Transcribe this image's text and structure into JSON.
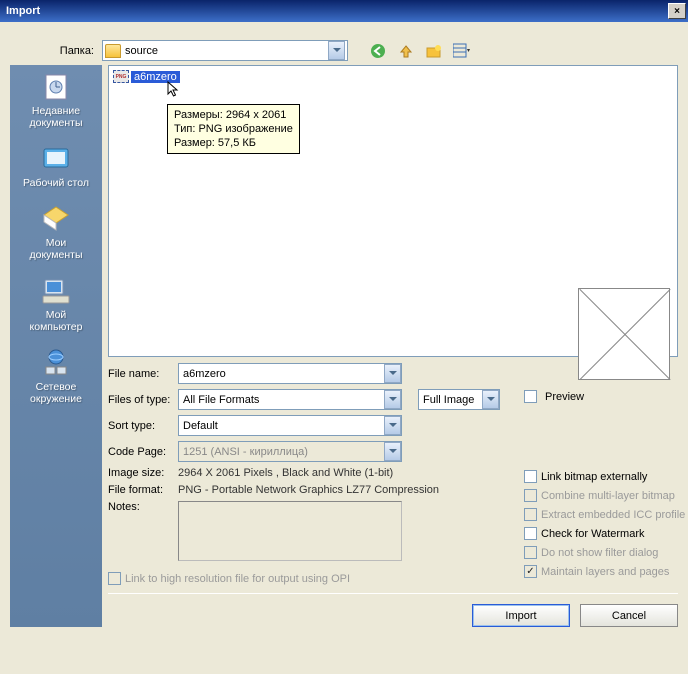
{
  "title": "Import",
  "folder_label": "Папка:",
  "folder_value": "source",
  "places": [
    {
      "label": "Недавние\nдокументы"
    },
    {
      "label": "Рабочий стол"
    },
    {
      "label": "Мои\nдокументы"
    },
    {
      "label": "Мой\nкомпьютер"
    },
    {
      "label": "Сетевое\nокружение"
    }
  ],
  "file_item": "a6mzero",
  "tooltip": {
    "l1": "Размеры: 2964 x 2061",
    "l2": "Тип: PNG изображение",
    "l3": "Размер: 57,5 КБ"
  },
  "form": {
    "file_name_lbl": "File name:",
    "file_name_val": "a6mzero",
    "files_type_lbl": "Files of type:",
    "files_type_val": "All File Formats",
    "full_image": "Full Image",
    "preview_chk": "Preview",
    "sort_lbl": "Sort type:",
    "sort_val": "Default",
    "codepage_lbl": "Code Page:",
    "codepage_val": "1251 (ANSI - кириллица)",
    "imgsize_lbl": "Image size:",
    "imgsize_val": "2964 X 2061 Pixels , Black and White (1-bit)",
    "fileformat_lbl": "File format:",
    "fileformat_val": "PNG - Portable Network Graphics LZ77 Compression",
    "notes_lbl": "Notes:"
  },
  "checks": {
    "link_bitmap": "Link bitmap externally",
    "combine": "Combine multi-layer bitmap",
    "extract_icc": "Extract embedded ICC profile",
    "watermark": "Check for Watermark",
    "no_filter": "Do not show filter dialog",
    "maintain": "Maintain layers and pages"
  },
  "opi": "Link to high resolution file for output using OPI",
  "import_btn": "Import",
  "cancel_btn": "Cancel"
}
